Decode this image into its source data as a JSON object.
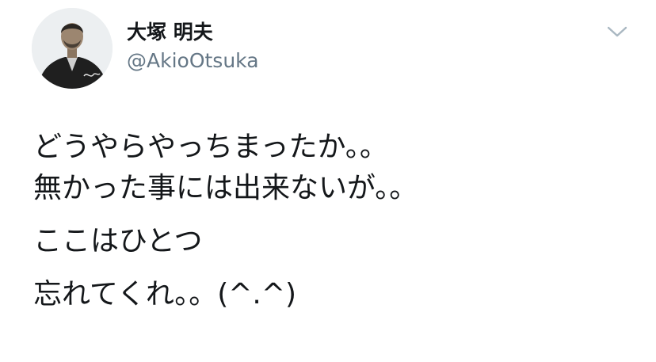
{
  "user": {
    "display_name": "大塚 明夫",
    "handle": "@AkioOtsuka",
    "avatar_icon": "portrait-avatar"
  },
  "menu": {
    "icon": "chevron-down-icon"
  },
  "tweet": {
    "lines": [
      "どうやらやっちまったか。。",
      "無かった事には出来ないが。。",
      "ここはひとつ",
      "忘れてくれ。。(^.^)"
    ]
  },
  "colors": {
    "text": "#14171a",
    "secondary": "#657786",
    "caret": "#aab8c2"
  }
}
